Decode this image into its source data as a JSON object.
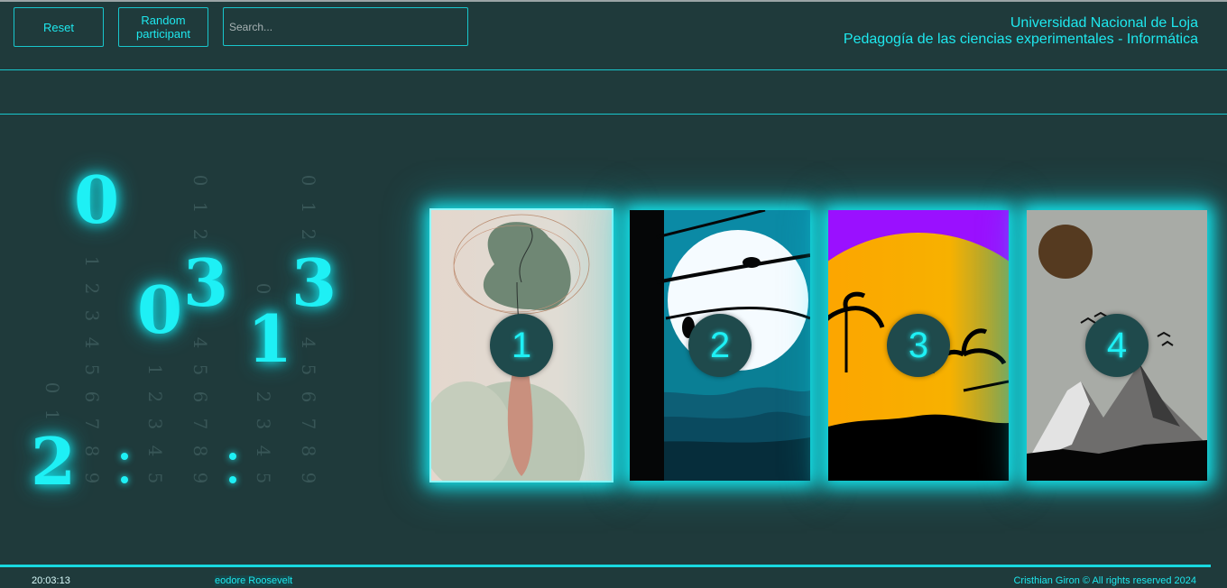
{
  "toolbar": {
    "reset_label": "Reset",
    "random_label": "Random participant",
    "search_placeholder": "Search..."
  },
  "header": {
    "university": "Universidad Nacional de Loja",
    "program": "Pedagogía de las ciencias experimentales - Informática"
  },
  "clock": {
    "hour_tens": "2",
    "hour_ones": "0",
    "minute_tens": "0",
    "minute_ones": "3",
    "second_tens": "1",
    "second_ones": "3"
  },
  "cards": [
    {
      "number": "1",
      "art": "abstract-tree-art"
    },
    {
      "number": "2",
      "art": "moon-night-bird-art"
    },
    {
      "number": "3",
      "art": "sunset-palms-art"
    },
    {
      "number": "4",
      "art": "mountain-birds-art"
    }
  ],
  "footer": {
    "time": "20:03:13",
    "marquee": "eodore Roosevelt",
    "copyright": "Cristhian Giron © All rights reserved 2024"
  },
  "colors": {
    "background": "#1f3a3b",
    "accent": "#1ee8ee"
  }
}
